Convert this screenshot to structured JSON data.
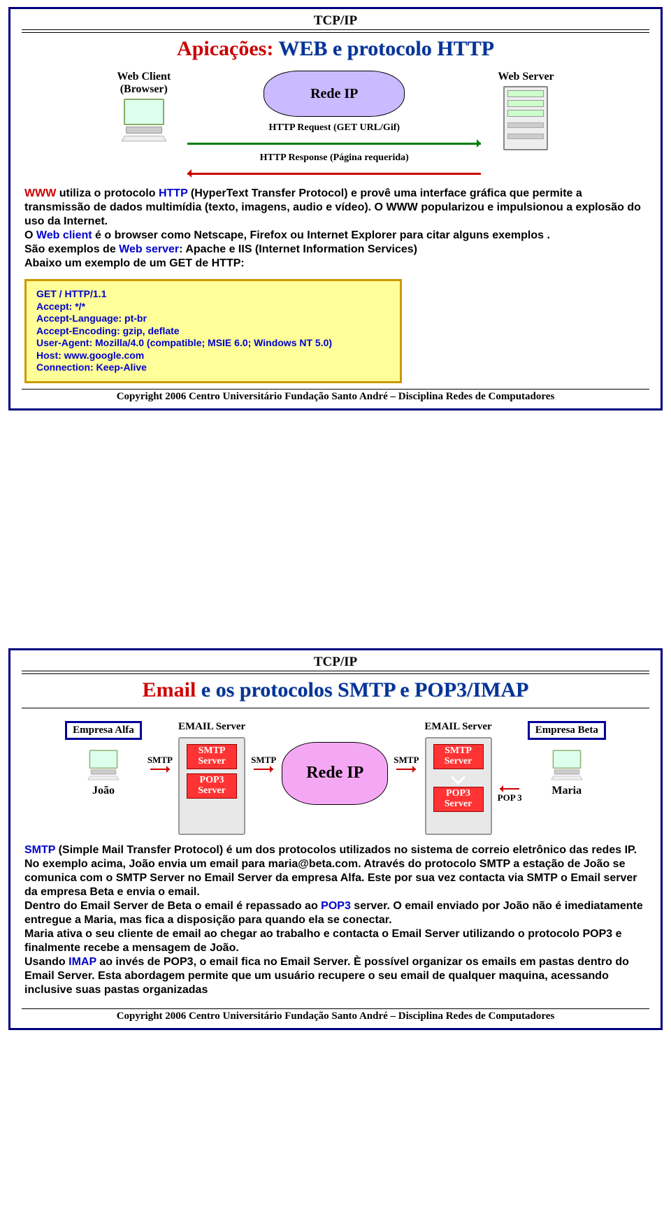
{
  "topic": "TCP/IP",
  "footer": "Copyright 2006 Centro Universitário Fundação Santo André – Disciplina Redes de Computadores",
  "slide1": {
    "title_red": "Apicações: ",
    "title_blue": "WEB e protocolo HTTP",
    "client_label_l1": "Web Client",
    "client_label_l2": "(Browser)",
    "cloud": "Rede IP",
    "server_label": "Web Server",
    "req_arrow": "HTTP Request  (GET URL/Gif)",
    "resp_arrow": "HTTP Response  (Página requerida)",
    "paragraph": {
      "p1a": "WWW",
      "p1b": " utiliza o protocolo ",
      "p1c": "HTTP",
      "p1d": " (HyperText Transfer Protocol) e provê uma interface gráfica que permite a transmissão de dados multimídia (texto, imagens, audio  e vídeo). O WWW popularizou e impulsionou a explosão do uso da Internet.",
      "p2a": "O ",
      "p2b": "Web client",
      "p2c": " é o browser como Netscape, Firefox ou Internet Explorer para citar alguns exemplos .",
      "p3a": "São exemplos de ",
      "p3b": "Web server",
      "p3c": ": Apache e IIS (Internet Information Services)",
      "p4": "Abaixo um exemplo de um GET de HTTP:"
    },
    "code": {
      "l1": "GET / HTTP/1.1",
      "l2": "Accept: */*",
      "l3": "Accept-Language: pt-br",
      "l4": "Accept-Encoding: gzip, deflate",
      "l5": "User-Agent: Mozilla/4.0 (compatible; MSIE 6.0; Windows NT 5.0)",
      "l6": "Host: www.google.com",
      "l7": "Connection: Keep-Alive"
    }
  },
  "slide2": {
    "title_red_a": "Email ",
    "title_blue": "e os protocolos SMTP e POP3/IMAP",
    "empresa_alfa": "Empresa Alfa",
    "empresa_beta": "Empresa Beta",
    "email_server": "EMAIL Server",
    "smtp": "SMTP",
    "pop3": "POP 3",
    "smtp_server": "SMTP Server",
    "pop3_server": "POP3 Server",
    "cloud": "Rede IP",
    "joao": "João",
    "maria": "Maria",
    "paragraph": {
      "p1a": "SMTP",
      "p1b": " (Simple Mail Transfer Protocol) é um dos protocolos utilizados no sistema de correio eletrônico das redes IP. No exemplo acima, João envia um email para maria@beta.com. Através do protocolo SMTP a estação de João se comunica com o SMTP Server no Email Server da empresa Alfa. Este por sua vez contacta via SMTP o Email server da empresa Beta e envia o email.",
      "p2a": "Dentro do Email Server de Beta o email é repassado ao ",
      "p2b": "POP3",
      "p2c": " server. O email enviado por João não é imediatamente entregue a Maria, mas fica a disposição para quando ela se conectar.",
      "p3": "Maria ativa o seu cliente de email ao chegar ao trabalho e contacta o Email Server utilizando o protocolo POP3 e finalmente recebe a mensagem de João.",
      "p4a": "Usando ",
      "p4b": "IMAP",
      "p4c": " ao invés de POP3, o email fica no Email Server. È possível organizar os emails em pastas dentro do Email Server. Esta abordagem permite que um usuário recupere o seu email de qualquer maquina, acessando inclusive suas pastas organizadas"
    }
  }
}
